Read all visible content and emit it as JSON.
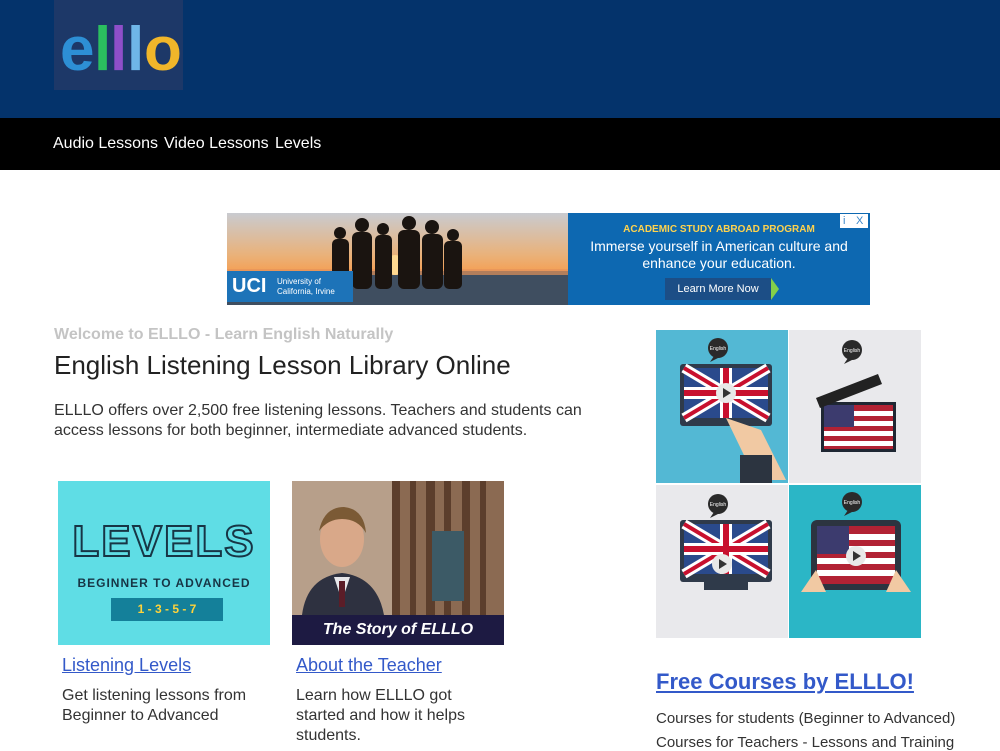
{
  "logo": {
    "letters": [
      "e",
      "l",
      "l",
      "l",
      "o"
    ],
    "colors": [
      "#2d8fd5",
      "#2bbf5f",
      "#8f4fc9",
      "#6fb6e8",
      "#f0b62a"
    ]
  },
  "nav": {
    "items": [
      "Audio Lessons",
      "Video Lessons",
      "Levels"
    ]
  },
  "ad": {
    "badge_logo": "UCI",
    "badge_text": "University of California, Irvine",
    "kicker": "ACADEMIC STUDY ABROAD PROGRAM",
    "body": "Immerse yourself in American culture and enhance your education.",
    "cta": "Learn More Now",
    "info_icon": "i",
    "close_icon": "X"
  },
  "main": {
    "welcome": "Welcome to ELLLO - Learn English Naturally",
    "title": "English Listening Lesson Library Online",
    "intro": "ELLLO offers over 2,500 free listening lessons. Teachers and students can access lessons for both beginner, intermediate advanced students."
  },
  "cards": [
    {
      "img_title": "LEVELS",
      "img_sub": "BEGINNER TO ADVANCED",
      "img_nums": "1 - 3 - 5 - 7",
      "link": "Listening Levels",
      "desc": "Get listening lessons from Beginner to Advanced"
    },
    {
      "img_caption": "The Story of ELLLO",
      "link": "About the Teacher",
      "desc": "Learn how ELLLO got started and how it helps students."
    }
  ],
  "sidebar": {
    "bubble_label": "English",
    "free_courses_link": "Free Courses by ELLLO!",
    "courses": [
      "Courses for students (Beginner to Advanced)",
      "Courses for Teachers - Lessons and Training"
    ]
  },
  "colors": {
    "header": "#04336b",
    "nav": "#000000",
    "link": "#3359c9"
  }
}
